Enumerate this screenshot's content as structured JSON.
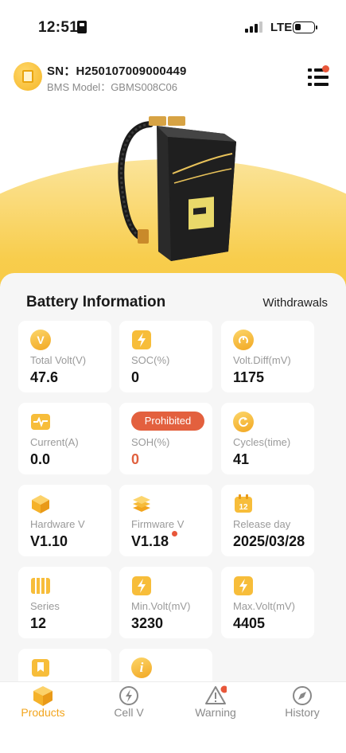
{
  "status_bar": {
    "time": "12:51",
    "network": "LTE"
  },
  "header": {
    "sn": "SN：H250107009000449",
    "model": "BMS Model：GBMS008C06"
  },
  "section": {
    "title": "Battery Information",
    "action": "Withdrawals"
  },
  "cards": [
    {
      "label": "Total Volt(V)",
      "value": "47.6",
      "icon": "volt-icon"
    },
    {
      "label": "SOC(%)",
      "value": "0",
      "icon": "bolt-icon"
    },
    {
      "label": "Volt.Diff(mV)",
      "value": "1175",
      "icon": "gauge-icon"
    },
    {
      "label": "Current(A)",
      "value": "0.0",
      "icon": "pulse-icon"
    },
    {
      "label": "SOH(%)",
      "value": "0",
      "badge": "Prohibited",
      "icon": ""
    },
    {
      "label": "Cycles(time)",
      "value": "41",
      "icon": "cycle-icon"
    },
    {
      "label": "Hardware V",
      "value": "V1.10",
      "icon": "cube-icon"
    },
    {
      "label": "Firmware V",
      "value": "V1.18",
      "icon": "layers-icon"
    },
    {
      "label": "Release day",
      "value": "2025/03/28",
      "icon": "calendar-icon"
    },
    {
      "label": "Series",
      "value": "12",
      "icon": "cells-icon"
    },
    {
      "label": "Min.Volt(mV)",
      "value": "3230",
      "icon": "bolt-icon"
    },
    {
      "label": "Max.Volt(mV)",
      "value": "4405",
      "icon": "bolt-icon"
    }
  ],
  "tabs": [
    {
      "label": "Products",
      "active": true
    },
    {
      "label": "Cell V",
      "active": false
    },
    {
      "label": "Warning",
      "active": false
    },
    {
      "label": "History",
      "active": false
    }
  ],
  "colors": {
    "accent": "#f2a51e",
    "alert": "#e3603e"
  }
}
